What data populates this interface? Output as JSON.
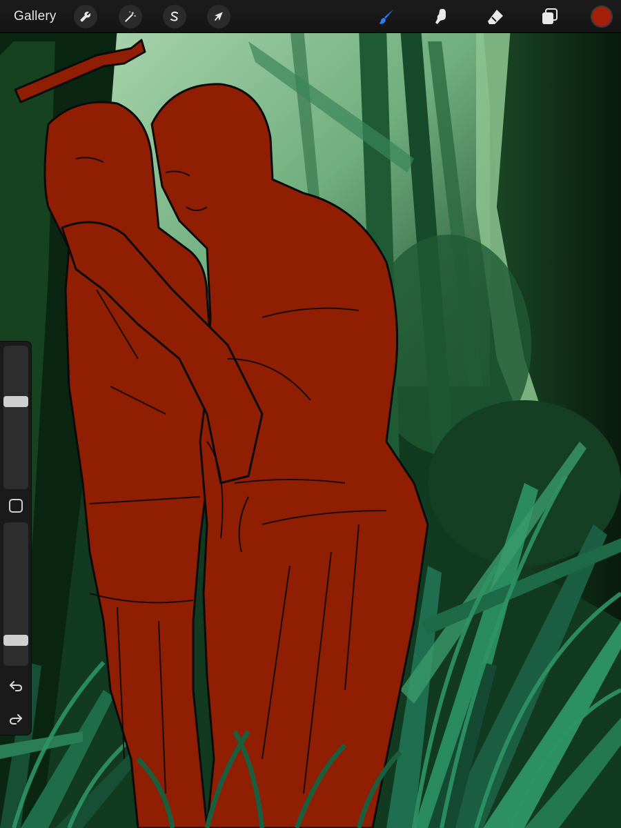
{
  "toolbar": {
    "gallery_label": "Gallery",
    "left_tools": [
      {
        "name": "actions",
        "icon": "wrench-icon"
      },
      {
        "name": "adjustments",
        "icon": "magic-wand-icon"
      },
      {
        "name": "selection",
        "icon": "selection-s-icon"
      },
      {
        "name": "transform",
        "icon": "arrow-cursor-icon"
      }
    ],
    "right_tools": [
      {
        "name": "brush",
        "icon": "brush-icon",
        "active": true
      },
      {
        "name": "smudge",
        "icon": "smudge-finger-icon",
        "active": false
      },
      {
        "name": "eraser",
        "icon": "eraser-icon",
        "active": false
      },
      {
        "name": "layers",
        "icon": "layers-icon",
        "active": false
      }
    ],
    "current_color": "#a31f0a",
    "active_tool_color": "#2f7cf6"
  },
  "sidebar": {
    "brush_size_level": 0.62,
    "opacity_level": 0.15,
    "modify_icon": "square-modify-icon",
    "undo_icon": "undo-icon",
    "redo_icon": "redo-icon"
  },
  "canvas": {
    "figure_color": "#8f1e03",
    "background_dark": "#0f2a17",
    "background_light": "#9cc9a2",
    "grass_color": "#1f6e4f"
  }
}
